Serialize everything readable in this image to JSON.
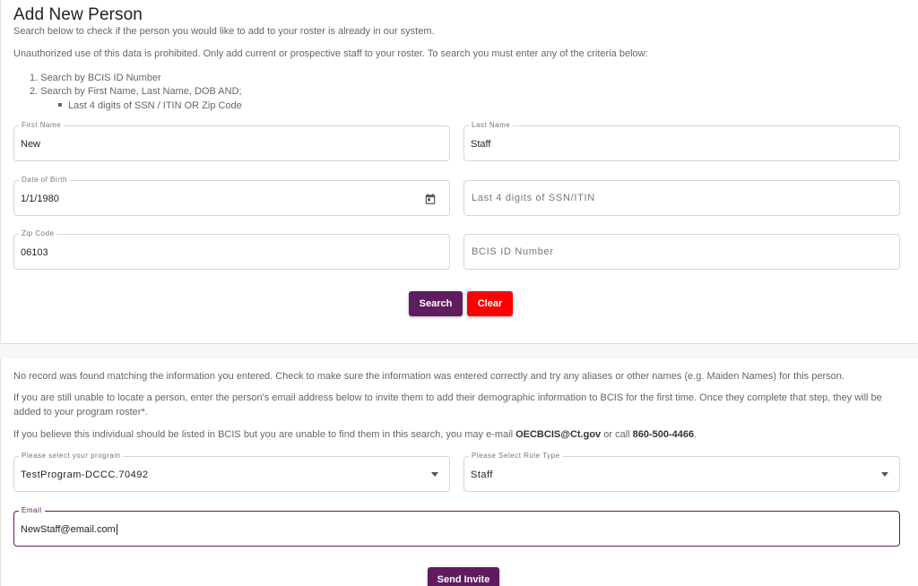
{
  "header": {
    "title": "Add New Person",
    "subtitle": "Search below to check if the person you would like to add to your roster is already in our system.",
    "warning": "Unauthorized use of this data is prohibited. Only add current or prospective staff to your roster. To search you must enter any of the criteria below:",
    "criteria": [
      "1. Search by BCIS ID Number",
      "2. Search by First Name, Last Name, DOB AND;"
    ],
    "sub_criteria": "Last 4 digits of SSN / ITIN OR Zip Code"
  },
  "search_form": {
    "first_name": {
      "label": "First Name",
      "value": "New"
    },
    "last_name": {
      "label": "Last Name",
      "value": "Staff"
    },
    "dob": {
      "label": "Date of Birth",
      "value": "1/1/1980"
    },
    "ssn": {
      "placeholder": "Last 4 digits of SSN/ITIN"
    },
    "zip": {
      "label": "Zip Code",
      "value": "06103"
    },
    "bcis_id": {
      "placeholder": "BCIS ID Number"
    },
    "search_label": "Search",
    "clear_label": "Clear"
  },
  "result": {
    "no_record": "No record was found matching the information you entered. Check to make sure the information was entered correctly and try any aliases or other names (e.g. Maiden Names) for this person.",
    "invite_line1": "If you are still unable to locate a person, enter the person's email address below to invite them to add their demographic information to BCIS for the first time. Once they complete that step, they will be",
    "invite_line2": "added to your program roster*.",
    "contact_prefix": "If you believe this individual should be listed in BCIS but you are unable to find them in this search, you may e-mail ",
    "contact_email": "OECBCIS@Ct.gov",
    "contact_mid": " or call ",
    "contact_phone": "860-500-4466",
    "contact_suffix": "."
  },
  "invite_form": {
    "program": {
      "label": "Please select your program",
      "value": "TestProgram-DCCC.70492"
    },
    "role": {
      "label": "Please Select Role Type",
      "value": "Staff"
    },
    "email": {
      "label": "Email",
      "value": "NewStaff@email.com"
    },
    "send_label": "Send Invite"
  },
  "colors": {
    "primary": "#5f1d5f",
    "danger": "#ff0000",
    "text": "#666666"
  },
  "icons": {
    "dob": "calendar-icon",
    "dropdown": "chevron-down-icon"
  }
}
